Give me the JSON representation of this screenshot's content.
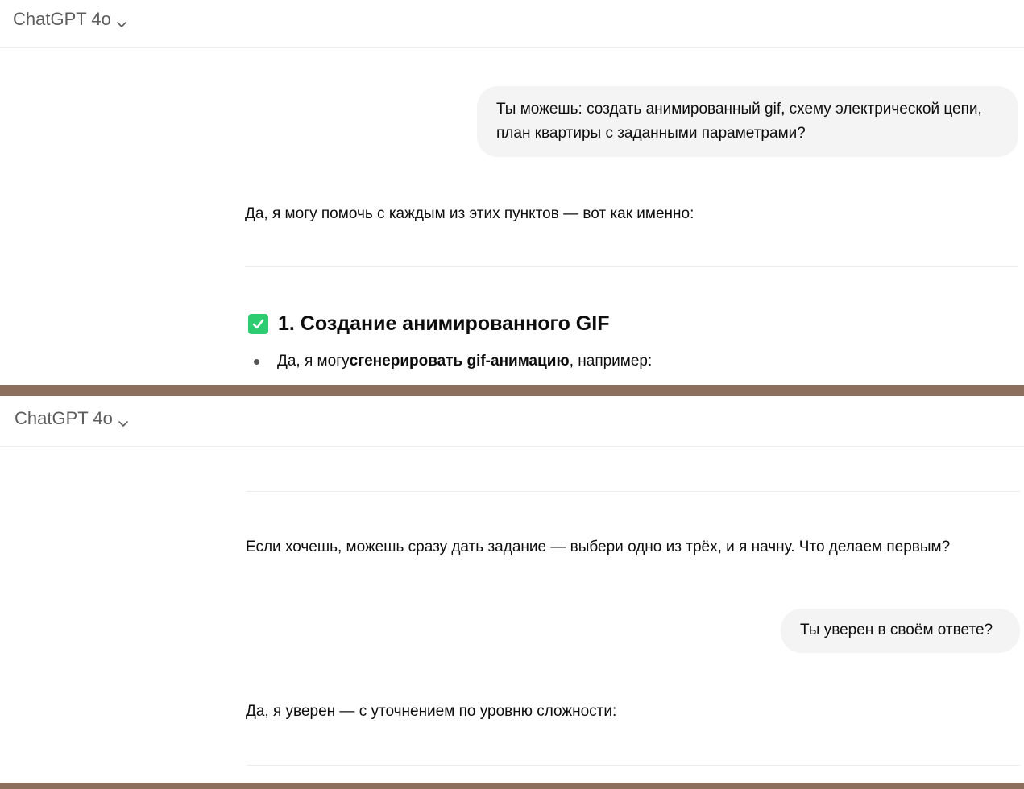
{
  "panels": [
    {
      "header": {
        "model_label": "ChatGPT 4o"
      },
      "user_message": "Ты можешь: создать анимированный gif, схему электрической цепи, план квартиры с заданными параметрами?",
      "assistant_intro": "Да, я могу помочь с каждым из этих пунктов — вот как именно:",
      "section_heading": "1. Создание анимированного GIF",
      "bullet": {
        "prefix": "Да, я могу ",
        "bold": "сгенерировать gif-анимацию",
        "suffix": ", например:"
      }
    },
    {
      "header": {
        "model_label": "ChatGPT 4o"
      },
      "assistant_followup": "Если хочешь, можешь сразу дать задание — выбери одно из трёх, и я начну. Что делаем первым?",
      "user_message": "Ты уверен в своём ответе?",
      "assistant_reply": "Да, я уверен — с уточнением по уровню сложности:"
    }
  ],
  "colors": {
    "divider": "#8c6f5c",
    "user_bubble": "#f4f4f4",
    "check_icon": "#2ecc71",
    "header_text": "#5d5d5d"
  },
  "icons": [
    "chevron-down-icon",
    "check-box-icon"
  ]
}
